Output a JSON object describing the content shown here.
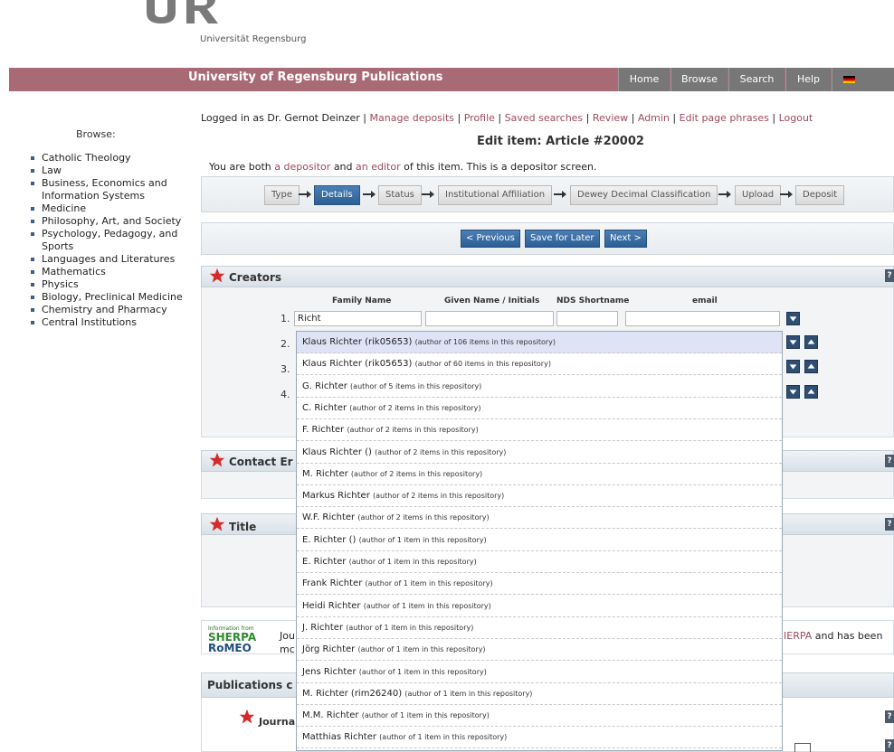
{
  "header": {
    "logo_text": "Universität Regensburg",
    "logo_letters": "UR",
    "site_title": "University of Regensburg Publications",
    "nav": [
      "Home",
      "Browse",
      "Search",
      "Help",
      "Deutsch"
    ]
  },
  "sidebar": {
    "title": "Browse:",
    "items": [
      "Catholic Theology",
      "Law",
      "Business, Economics and Information Systems",
      "Medicine",
      "Philosophy, Art, and Society",
      "Psychology, Pedagogy, and Sports",
      "Languages and Literatures",
      "Mathematics",
      "Physics",
      "Biology, Preclinical Medicine",
      "Chemistry and Pharmacy",
      "Central Institutions"
    ]
  },
  "login": {
    "prefix": "Logged in as Dr. Gernot Deinzer |",
    "links": [
      "Manage deposits",
      "Profile",
      "Saved searches",
      "Review",
      "Admin",
      "Edit page phrases",
      "Logout"
    ],
    "separator": "|"
  },
  "page": {
    "title": "Edit item: Article #20002",
    "notice": {
      "part1": "You are both",
      "link1": "a depositor",
      "part2": "and",
      "link2": "an editor",
      "part3": "of this item. This is a depositor screen."
    }
  },
  "stages": [
    "Type",
    "Details",
    "Status",
    "Institutional Affiliation",
    "Dewey Decimal Classification",
    "Upload",
    "Deposit"
  ],
  "active_stage": "Details",
  "buttons": {
    "previous": "< Previous",
    "save": "Save for Later",
    "next": "Next >"
  },
  "sections": {
    "creators": "Creators",
    "contact": "Contact Er",
    "title": "Title",
    "publications": "Publications c",
    "journal": "Journa"
  },
  "creators": {
    "columns": [
      "Family Name",
      "Given Name / Initials",
      "NDS Shortname",
      "email"
    ],
    "row_numbers": [
      "1.",
      "2.",
      "3.",
      "4."
    ],
    "family_value": "Richt"
  },
  "suggestions": [
    {
      "name": "Klaus Richter (rik05653)",
      "meta": "(author of 106 items in this repository)"
    },
    {
      "name": "Klaus Richter (rik05653)",
      "meta": "(author of 60 items in this repository)"
    },
    {
      "name": "G. Richter",
      "meta": "(author of 5 items in this repository)"
    },
    {
      "name": "C. Richter",
      "meta": "(author of 2 items in this repository)"
    },
    {
      "name": "F. Richter",
      "meta": "(author of 2 items in this repository)"
    },
    {
      "name": "Klaus Richter ()",
      "meta": "(author of 2 items in this repository)"
    },
    {
      "name": "M. Richter",
      "meta": "(author of 2 items in this repository)"
    },
    {
      "name": "Markus Richter",
      "meta": "(author of 2 items in this repository)"
    },
    {
      "name": "W.F. Richter",
      "meta": "(author of 2 items in this repository)"
    },
    {
      "name": "E. Richter ()",
      "meta": "(author of 1 item in this repository)"
    },
    {
      "name": "E. Richter",
      "meta": "(author of 1 item in this repository)"
    },
    {
      "name": "Frank Richter",
      "meta": "(author of 1 item in this repository)"
    },
    {
      "name": "Heidi Richter",
      "meta": "(author of 1 item in this repository)"
    },
    {
      "name": "J. Richter",
      "meta": "(author of 1 item in this repository)"
    },
    {
      "name": "Jörg Richter",
      "meta": "(author of 1 item in this repository)"
    },
    {
      "name": "Jens Richter",
      "meta": "(author of 1 item in this repository)"
    },
    {
      "name": "M. Richter (rim26240)",
      "meta": "(author of 1 item in this repository)"
    },
    {
      "name": "M.M. Richter",
      "meta": "(author of 1 item in this repository)"
    },
    {
      "name": "Matthias Richter",
      "meta": "(author of 1 item in this repository)"
    }
  ],
  "romeo": {
    "info_from": "Information from",
    "logo_line1": "SHERPA",
    "logo_line2": "RoMEO",
    "text_left_1": "Jou",
    "text_left_2": "mc",
    "link_right": "IERPA",
    "text_right": "and has been"
  },
  "colors": {
    "topbar": "#a86a75",
    "nav_bg": "#777777",
    "link": "#9c4a5e",
    "active_stage": "#2c5f94",
    "highlight": "#dfe3f6",
    "star": "#d62a2a"
  }
}
